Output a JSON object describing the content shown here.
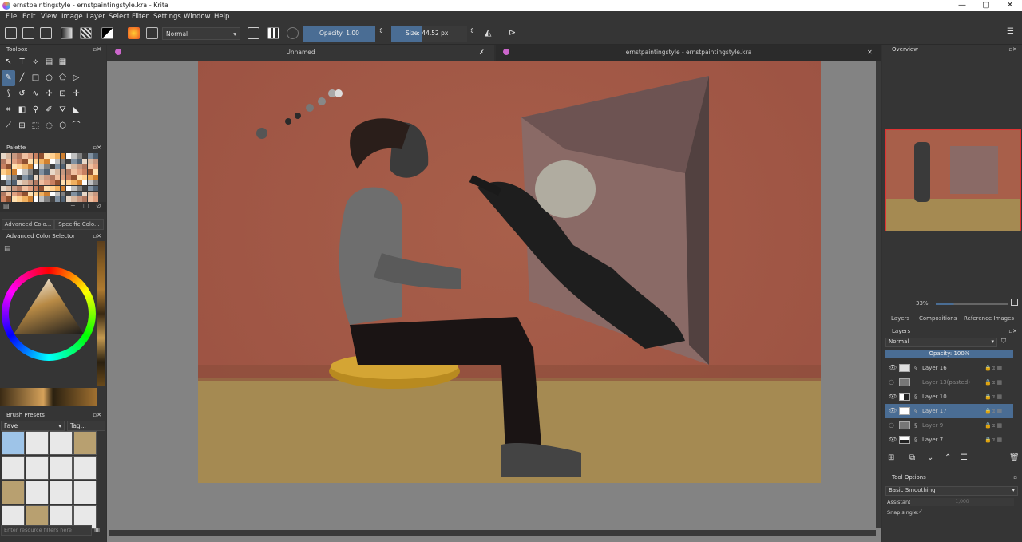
{
  "window": {
    "title": "ernstpaintingstyle - ernstpaintingstyle.kra - Krita",
    "min": "—",
    "max": "▢",
    "close": "✕"
  },
  "menu": [
    "File",
    "Edit",
    "View",
    "Image",
    "Layer",
    "Select",
    "Filter",
    "Settings",
    "Window",
    "Help"
  ],
  "toolbar": {
    "blend_mode": "Normal",
    "opacity_label": "Opacity: 1.00",
    "size_label": "Size: 44.52 px"
  },
  "tabs": {
    "left": "Unnamed",
    "right": "ernstpaintingstyle - ernstpaintingstyle.kra"
  },
  "left_dock": {
    "toolbox_title": "Toolbox",
    "palette_title": "Palette",
    "color_tabs": [
      "Advanced Colo...",
      "Specific Colo..."
    ],
    "color_selector_title": "Advanced Color Selector",
    "brush_presets_title": "Brush Presets",
    "brush_tag": "Fave",
    "brush_tag_btn": "Tag...",
    "resource_filter_placeholder": "Enter resource filters here"
  },
  "right_dock": {
    "overview_title": "Overview",
    "zoom": "33%",
    "tabs": [
      "Layers",
      "Compositions",
      "Reference Images"
    ],
    "layers_title": "Layers",
    "blend_mode": "Normal",
    "opacity": "Opacity:  100%",
    "layers": [
      {
        "name": "Layer 16",
        "visible": true,
        "selected": false
      },
      {
        "name": "Layer 13(pasted)",
        "visible": false,
        "selected": false
      },
      {
        "name": "Layer 10",
        "visible": true,
        "selected": false
      },
      {
        "name": "Layer 17",
        "visible": true,
        "selected": true
      },
      {
        "name": "Layer 9",
        "visible": false,
        "selected": false
      },
      {
        "name": "Layer 7",
        "visible": true,
        "selected": false
      }
    ],
    "tool_options_title": "Tool Options",
    "smoothing": "Basic Smoothing",
    "assistant_label": "Assistant",
    "assistant_value": "1,000",
    "snap_label": "Snap single:",
    "snap_check": "✓"
  },
  "colors": {
    "accent": "#4a6d94",
    "wall": "#a85f4a",
    "floor": "#a58a52"
  }
}
